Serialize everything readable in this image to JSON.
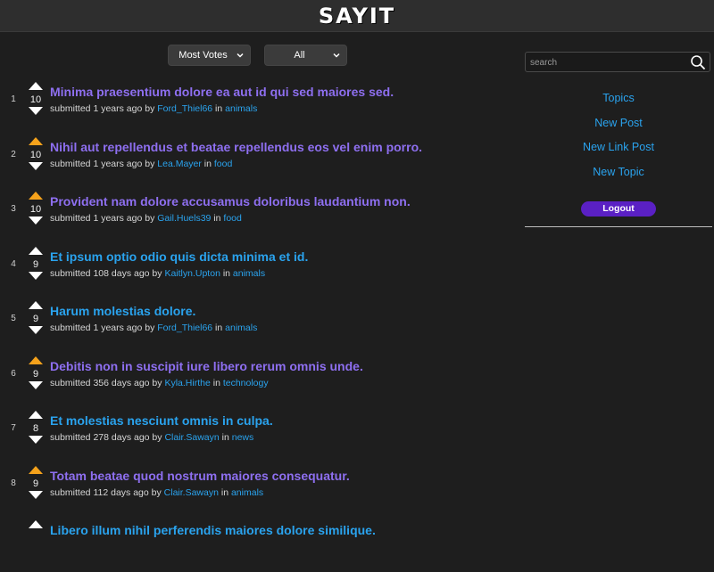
{
  "app": {
    "logo": "SAYIT"
  },
  "filters": {
    "sort": "Most Votes",
    "scope": "All"
  },
  "sidebar": {
    "search_placeholder": "search",
    "links": [
      "Topics",
      "New Post",
      "New Link Post",
      "New Topic"
    ],
    "logout_label": "Logout"
  },
  "posts": [
    {
      "rank": "1",
      "score": "10",
      "title": "Minima praesentium dolore ea aut id qui sed maiores sed.",
      "age": "1 years ago",
      "author": "Ford_Thiel66",
      "topic": "animals",
      "upvoted": false,
      "visited": true
    },
    {
      "rank": "2",
      "score": "10",
      "title": "Nihil aut repellendus et beatae repellendus eos vel enim porro.",
      "age": "1 years ago",
      "author": "Lea.Mayer",
      "topic": "food",
      "upvoted": true,
      "visited": true
    },
    {
      "rank": "3",
      "score": "10",
      "title": "Provident nam dolore accusamus doloribus laudantium non.",
      "age": "1 years ago",
      "author": "Gail.Huels39",
      "topic": "food",
      "upvoted": true,
      "visited": true
    },
    {
      "rank": "4",
      "score": "9",
      "title": "Et ipsum optio odio quis dicta minima et id.",
      "age": "108 days ago",
      "author": "Kaitlyn.Upton",
      "topic": "animals",
      "upvoted": false,
      "visited": false
    },
    {
      "rank": "5",
      "score": "9",
      "title": "Harum molestias dolore.",
      "age": "1 years ago",
      "author": "Ford_Thiel66",
      "topic": "animals",
      "upvoted": false,
      "visited": false
    },
    {
      "rank": "6",
      "score": "9",
      "title": "Debitis non in suscipit iure libero rerum omnis unde.",
      "age": "356 days ago",
      "author": "Kyla.Hirthe",
      "topic": "technology",
      "upvoted": true,
      "visited": true
    },
    {
      "rank": "7",
      "score": "8",
      "title": "Et molestias nesciunt omnis in culpa.",
      "age": "278 days ago",
      "author": "Clair.Sawayn",
      "topic": "news",
      "upvoted": false,
      "visited": false
    },
    {
      "rank": "8",
      "score": "9",
      "title": "Totam beatae quod nostrum maiores consequatur.",
      "age": "112 days ago",
      "author": "Clair.Sawayn",
      "topic": "animals",
      "upvoted": true,
      "visited": true
    },
    {
      "rank": "",
      "score": "",
      "title": "Libero illum nihil perferendis maiores dolore similique.",
      "age": "",
      "author": "",
      "topic": "",
      "upvoted": false,
      "visited": false
    }
  ],
  "colors": {
    "upvote_active": "#f5a21b",
    "vote_inactive": "#ffffff",
    "link": "#2aa3ee",
    "visited": "#8e6ff0",
    "logout_bg": "#5a20c4"
  }
}
